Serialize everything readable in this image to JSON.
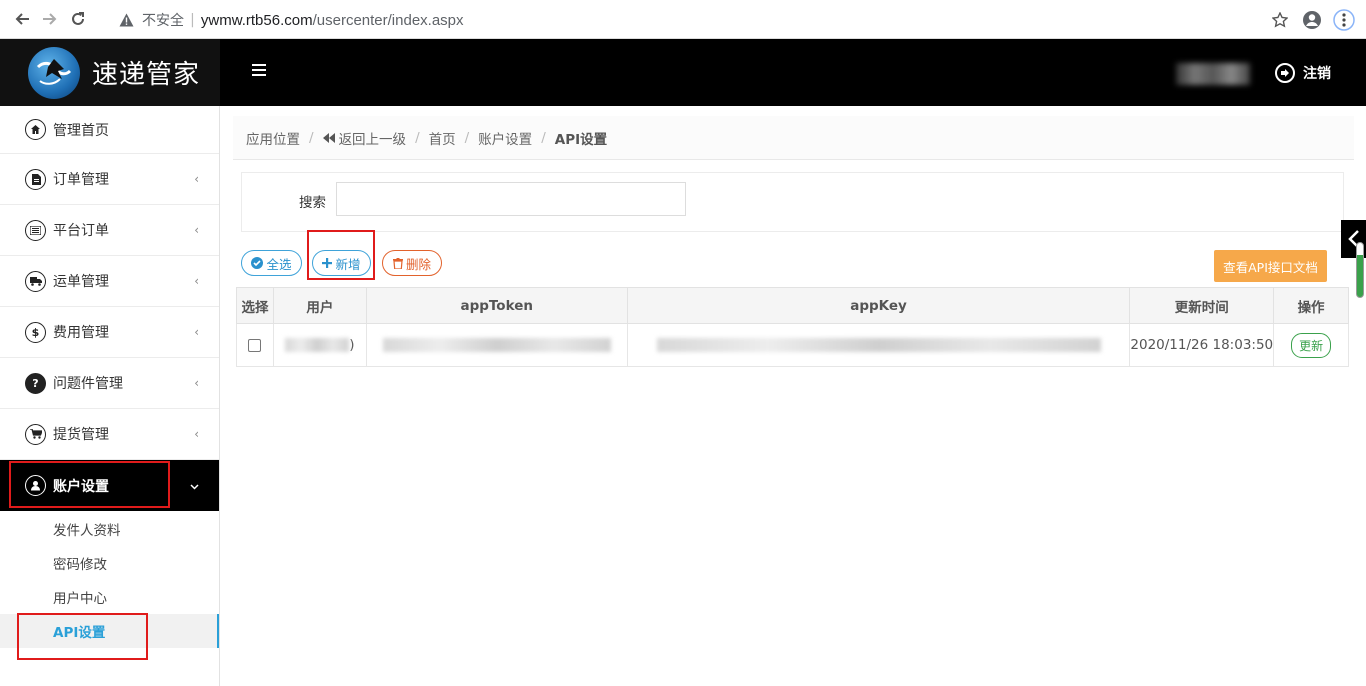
{
  "browser": {
    "security_label": "不安全",
    "url_host": "ywmw.rtb56.com",
    "url_path": "/usercenter/index.aspx"
  },
  "header": {
    "app_title": "速递管家",
    "logout_label": "注销"
  },
  "sidebar": {
    "items": [
      {
        "label": "管理首页",
        "icon": "home-icon"
      },
      {
        "label": "订单管理",
        "icon": "document-icon"
      },
      {
        "label": "平台订单",
        "icon": "list-icon"
      },
      {
        "label": "运单管理",
        "icon": "truck-icon"
      },
      {
        "label": "费用管理",
        "icon": "dollar-icon"
      },
      {
        "label": "问题件管理",
        "icon": "question-icon"
      },
      {
        "label": "提货管理",
        "icon": "cart-icon"
      },
      {
        "label": "账户设置",
        "icon": "user-icon"
      }
    ],
    "sub_items": [
      {
        "label": "发件人资料"
      },
      {
        "label": "密码修改"
      },
      {
        "label": "用户中心"
      },
      {
        "label": "API设置"
      }
    ]
  },
  "breadcrumb": {
    "root": "应用位置",
    "back": "返回上一级",
    "home": "首页",
    "section": "账户设置",
    "current": "API设置"
  },
  "search": {
    "label": "搜索",
    "value": ""
  },
  "toolbar": {
    "select_all": "全选",
    "add": "新增",
    "delete": "删除",
    "api_doc": "查看API接口文档"
  },
  "table": {
    "columns": [
      "选择",
      "用户",
      "appToken",
      "appKey",
      "更新时间",
      "操作"
    ],
    "rows": [
      {
        "user_suffix": ")",
        "updated": "2020/11/26 18:03:50",
        "action": "更新"
      }
    ]
  },
  "colors": {
    "accent_blue": "#2aa0d8",
    "danger_orange": "#e2622c",
    "api_button": "#f6a84a",
    "update_green": "#3aa14b",
    "highlight_red": "#e01b1b"
  }
}
